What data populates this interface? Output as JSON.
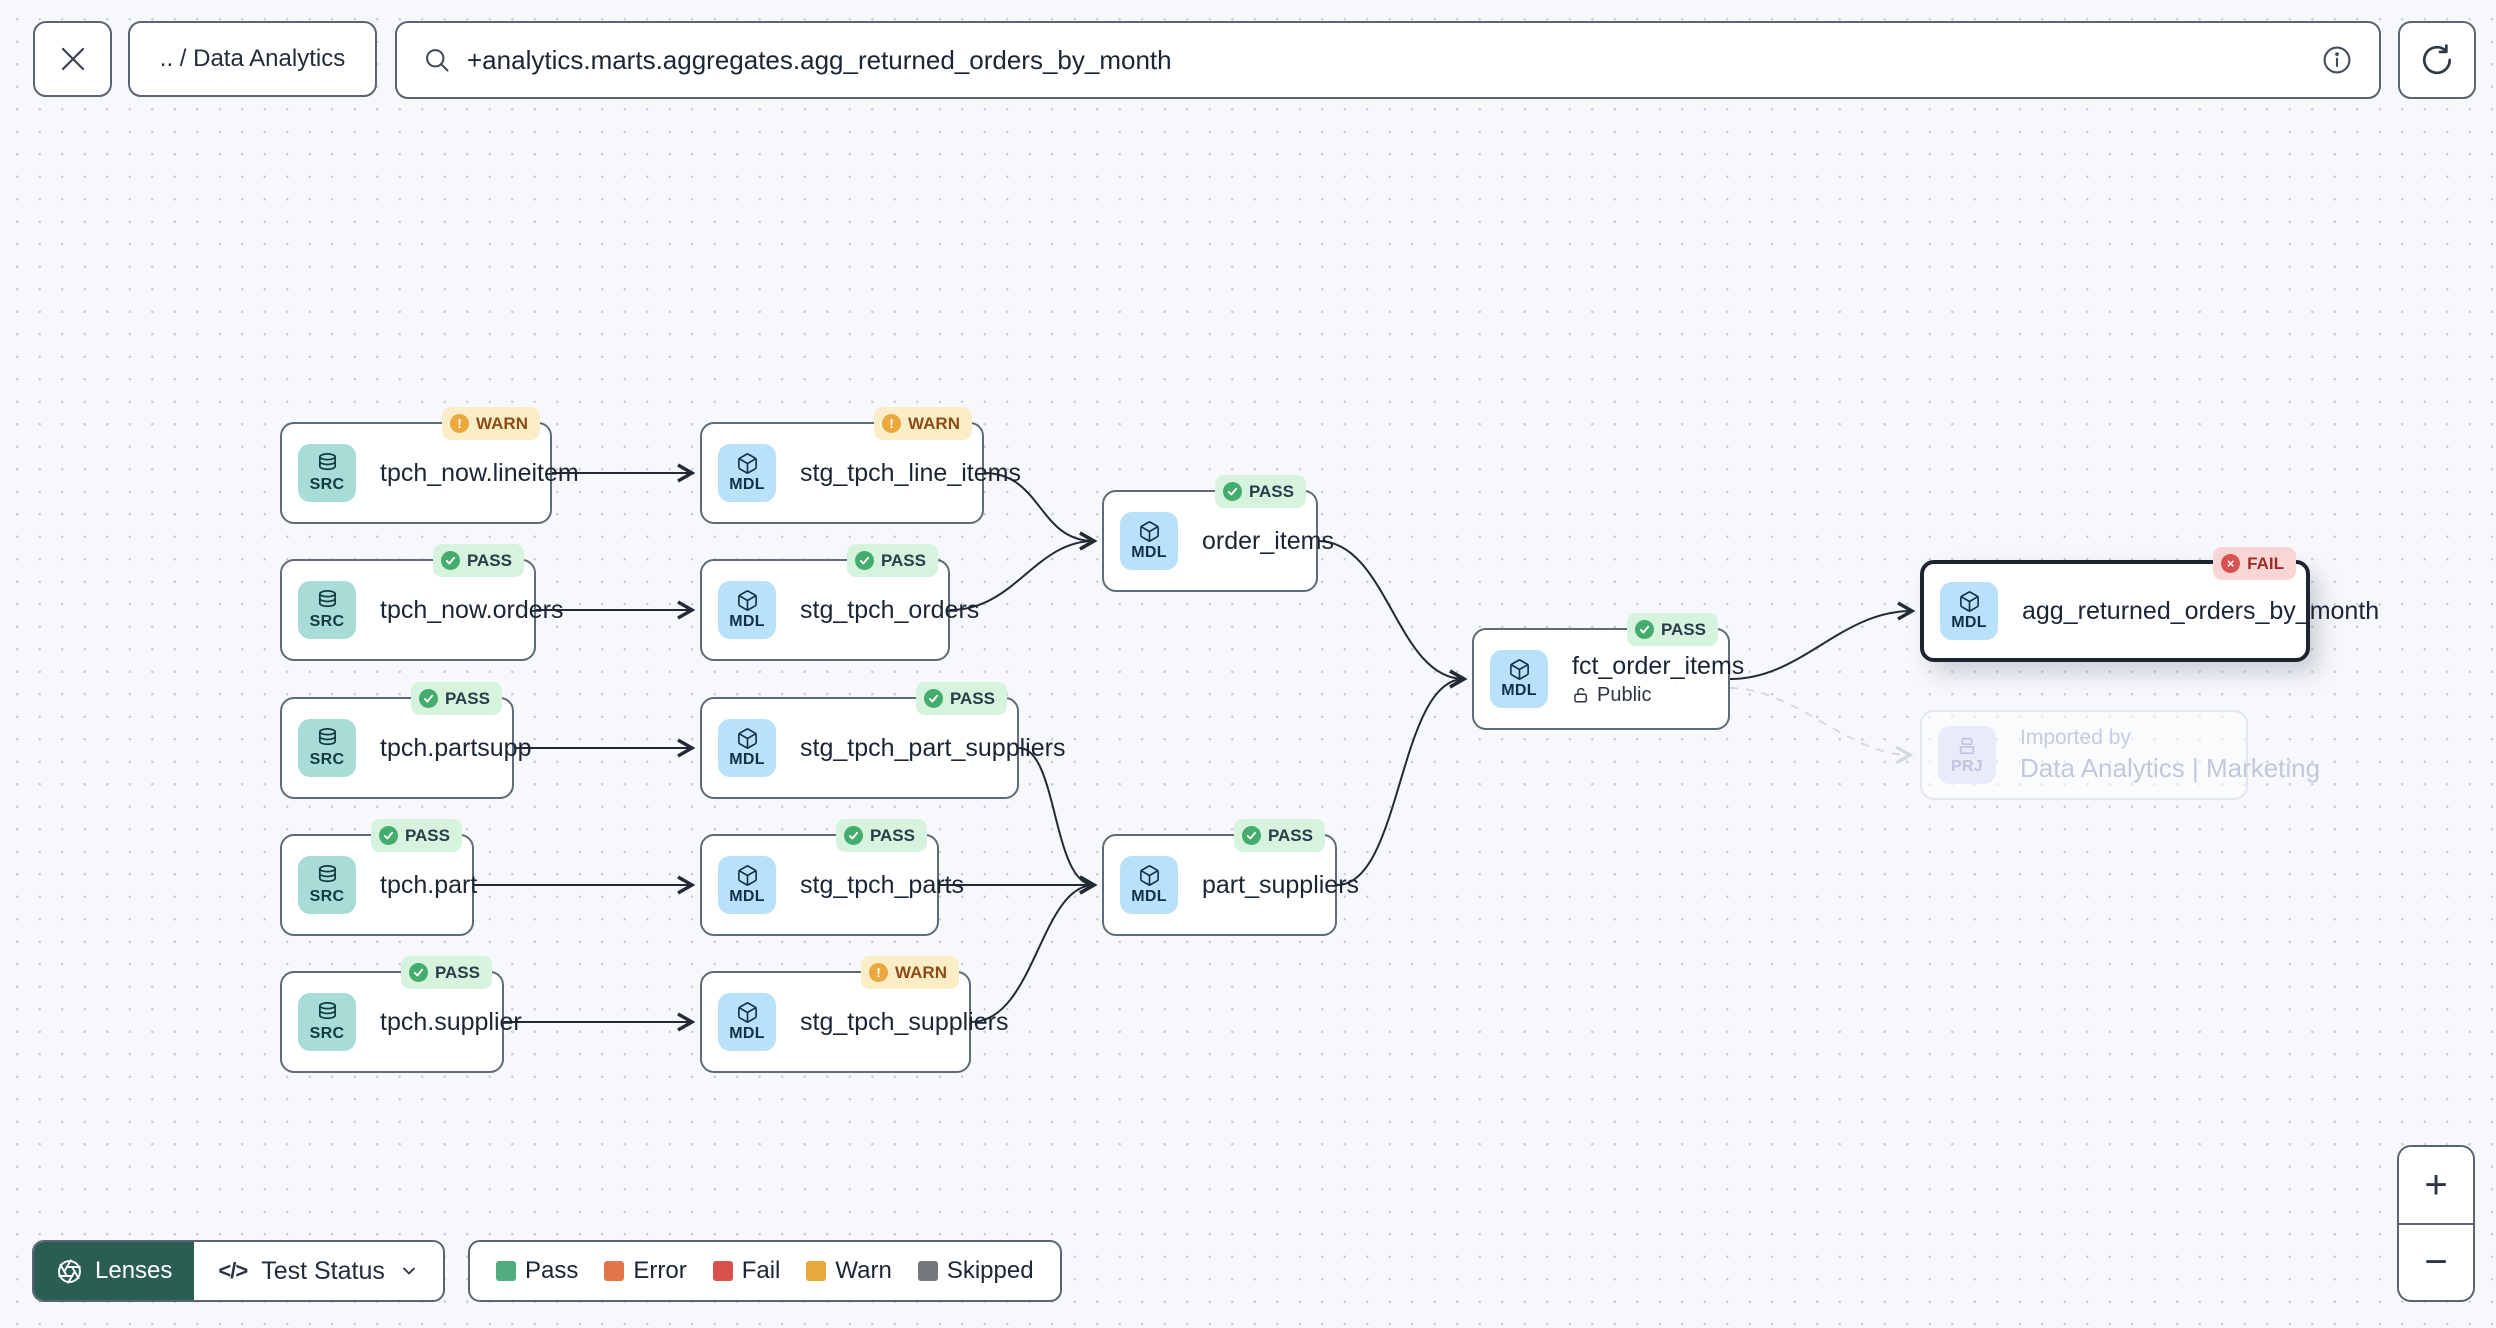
{
  "topbar": {
    "breadcrumb": ".. / Data Analytics",
    "search": {
      "value": "+analytics.marts.aggregates.agg_returned_orders_by_month"
    }
  },
  "graph": {
    "nodes": [
      {
        "type": "SRC",
        "title": "tpch_now.lineitem",
        "status": "WARN"
      },
      {
        "type": "SRC",
        "title": "tpch_now.orders",
        "status": "PASS"
      },
      {
        "type": "SRC",
        "title": "tpch.partsupp",
        "status": "PASS"
      },
      {
        "type": "SRC",
        "title": "tpch.part",
        "status": "PASS"
      },
      {
        "type": "SRC",
        "title": "tpch.supplier",
        "status": "PASS"
      },
      {
        "type": "MDL",
        "title": "stg_tpch_line_items",
        "status": "WARN"
      },
      {
        "type": "MDL",
        "title": "stg_tpch_orders",
        "status": "PASS"
      },
      {
        "type": "MDL",
        "title": "stg_tpch_part_suppliers",
        "status": "PASS"
      },
      {
        "type": "MDL",
        "title": "stg_tpch_parts",
        "status": "PASS"
      },
      {
        "type": "MDL",
        "title": "stg_tpch_suppliers",
        "status": "WARN"
      },
      {
        "type": "MDL",
        "title": "order_items",
        "status": "PASS"
      },
      {
        "type": "MDL",
        "title": "part_suppliers",
        "status": "PASS"
      },
      {
        "type": "MDL",
        "title": "fct_order_items",
        "status": "PASS",
        "access": "Public"
      },
      {
        "type": "MDL",
        "title": "agg_returned_orders_by_month",
        "status": "FAIL"
      }
    ],
    "ghost": {
      "type": "PRJ",
      "line1": "Imported by",
      "line2": "Data Analytics | Marketing"
    }
  },
  "toolbar": {
    "lenses_label": "Lenses",
    "code_icon": "</>",
    "lens_selected": "Test Status",
    "legend": [
      {
        "label": "Pass",
        "color": "#52ad7e"
      },
      {
        "label": "Error",
        "color": "#e2764a"
      },
      {
        "label": "Fail",
        "color": "#d8514c"
      },
      {
        "label": "Warn",
        "color": "#e8a83d"
      },
      {
        "label": "Skipped",
        "color": "#75787b"
      }
    ]
  },
  "zoom_controls": {
    "in": "+",
    "out": "−"
  },
  "colors": {
    "pass_badge_bg": "#d5f3dd",
    "warn_badge_bg": "#fbeec6",
    "fail_badge_bg": "#f9d6d3",
    "src_chip": "#a8dcd7",
    "mdl_chip": "#b9e2fa",
    "prj_chip": "#e9ebf9",
    "lenses_button": "#2b5e53",
    "edge": "#222a35"
  }
}
